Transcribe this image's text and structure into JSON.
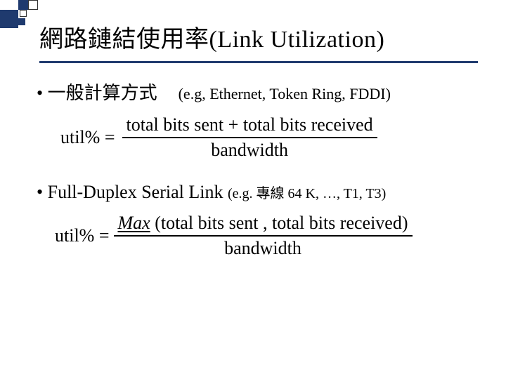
{
  "title": "網路鏈結使用率(Link Utilization)",
  "section1": {
    "bullet": "• 一般計算方式",
    "subnote": "(e.g, Ethernet, Token Ring, FDDI)",
    "formula": {
      "lhs": "util%  =",
      "numerator": "total bits sent + total bits received",
      "denominator": "bandwidth"
    }
  },
  "section2": {
    "bullet": "• Full-Duplex Serial Link",
    "subnote": "(e.g. 專線  64 K, …, T1, T3)",
    "formula": {
      "lhs": "util% =",
      "max_label": "Max",
      "numerator_rest": " (total bits sent , total bits received)",
      "denominator": "bandwidth"
    }
  }
}
